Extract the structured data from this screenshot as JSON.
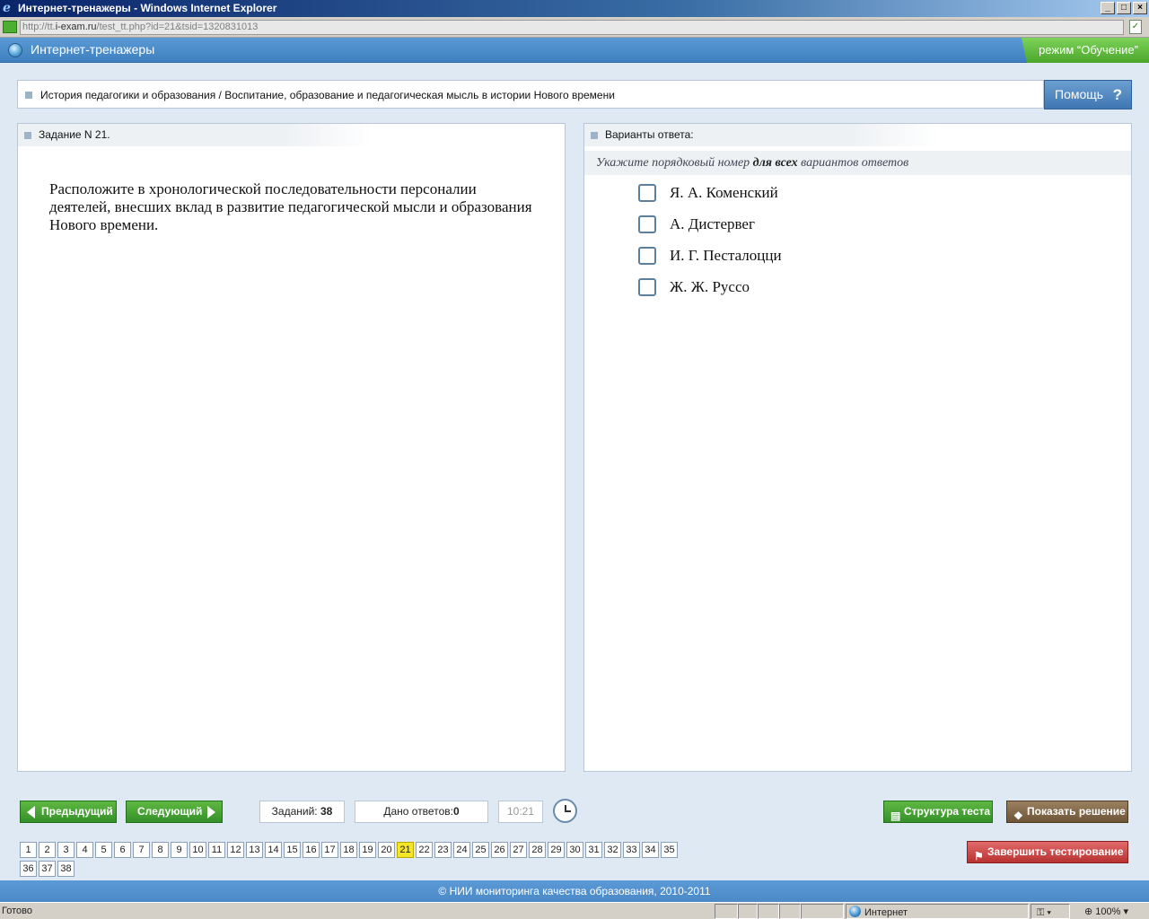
{
  "window": {
    "title": "Интернет-тренажеры - Windows Internet Explorer",
    "url_prefix": "http://tt.",
    "url_domain": "i-exam.ru",
    "url_path": "/test_tt.php?id=21&tsid=1320831013"
  },
  "header": {
    "app_title": "Интернет-тренажеры",
    "mode": "режим “Обучение”"
  },
  "breadcrumb": "История педагогики и образования / Воспитание, образование и педагогическая мысль в истории Нового времени",
  "help_label": "Помощь",
  "help_symbol": "?",
  "task": {
    "header": "Задание N 21.",
    "question": "Расположите в хронологической последовательности персоналии деятелей, внесших вклад в развитие педагогической мысли и образования Нового времени."
  },
  "answers": {
    "header": "Варианты ответа:",
    "instruction_before": "Укажите порядковый номер ",
    "instruction_bold": "для всех",
    "instruction_after": " вариантов ответов",
    "options": [
      "Я. А. Коменский",
      "А. Дистервег",
      "И. Г. Песталоцци",
      "Ж. Ж. Руссо"
    ]
  },
  "toolbar": {
    "prev_label": "Предыдущий",
    "next_label": "Следующий",
    "total_label": "Заданий:",
    "total_value": "38",
    "answered_label": "Дано ответов:",
    "answered_value": "0",
    "time": "10:21",
    "structure_label": "Структура теста",
    "solution_label": "Показать решение",
    "finish_label": "Завершить тестирование"
  },
  "task_numbers": [
    "1",
    "2",
    "3",
    "4",
    "5",
    "6",
    "7",
    "8",
    "9",
    "10",
    "11",
    "12",
    "13",
    "14",
    "15",
    "16",
    "17",
    "18",
    "19",
    "20",
    "21",
    "22",
    "23",
    "24",
    "25",
    "26",
    "27",
    "28",
    "29",
    "30",
    "31",
    "32",
    "33",
    "34",
    "35",
    "36",
    "37",
    "38"
  ],
  "current_task": "21",
  "footer": "© НИИ мониторинга качества образования, 2010-2011",
  "statusbar": {
    "status": "Готово",
    "zone": "Интернет",
    "zoom": "100%"
  },
  "colors": {
    "header_blue": "#3f7fbf",
    "mode_green": "#4aa62a",
    "nav_green": "#35902a",
    "finish_red": "#b83232",
    "current_task_yellow": "#f5e625"
  }
}
